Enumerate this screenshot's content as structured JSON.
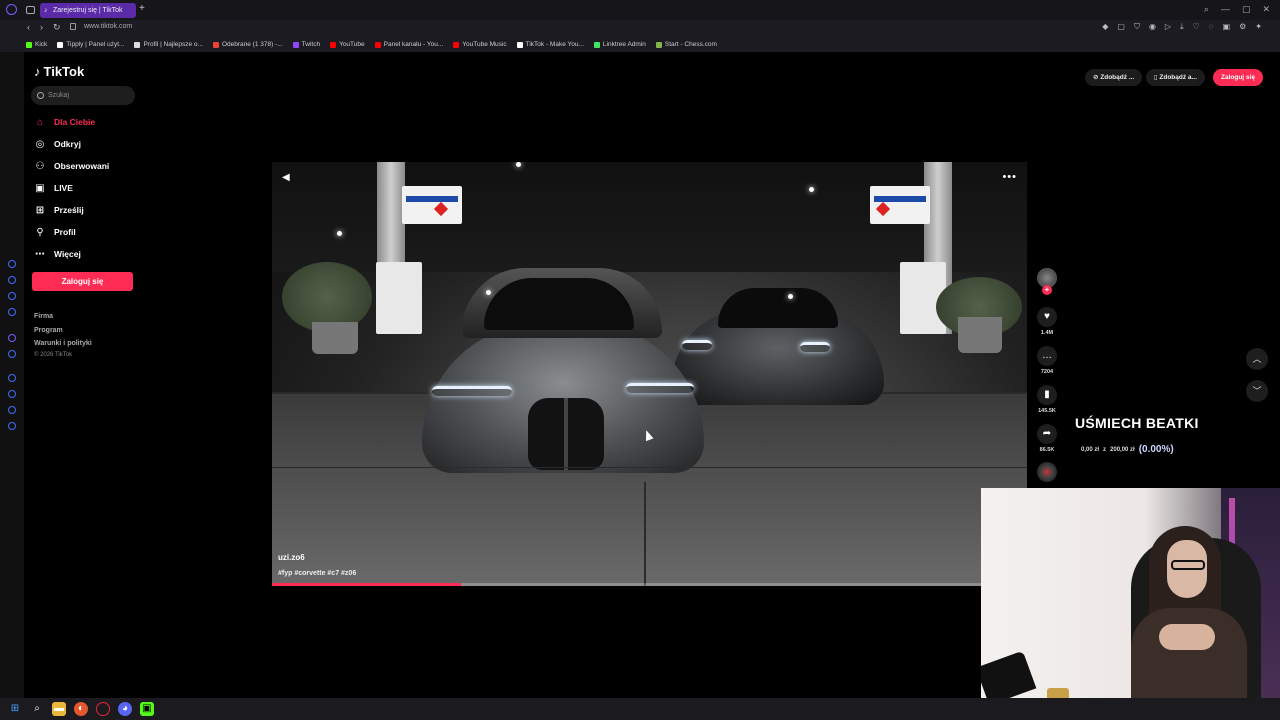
{
  "browser": {
    "tab_title": "Zarejestruj się | TikTok",
    "url": "www.tiktok.com",
    "bookmarks": [
      {
        "label": "Kick",
        "color": "#53fc18"
      },
      {
        "label": "Tipply | Panel użyt...",
        "color": "#ffffff"
      },
      {
        "label": "Profil | Najlepsze o...",
        "color": "#dddddd"
      },
      {
        "label": "Odebrane (1 378) -...",
        "color": "#ea4335"
      },
      {
        "label": "Twitch",
        "color": "#9146ff"
      },
      {
        "label": "YouTube",
        "color": "#ff0000"
      },
      {
        "label": "Panel kanału - You...",
        "color": "#ff0000"
      },
      {
        "label": "YouTube Music",
        "color": "#ff0000"
      },
      {
        "label": "TikTok - Make You...",
        "color": "#ffffff"
      },
      {
        "label": "Linktree Admin",
        "color": "#43e55e"
      },
      {
        "label": "Start - Chess.com",
        "color": "#81b64c"
      }
    ]
  },
  "sidebar": {
    "logo": "TikTok",
    "search_placeholder": "Szukaj",
    "nav": [
      {
        "label": "Dla Ciebie",
        "icon": "home-icon",
        "active": true
      },
      {
        "label": "Odkryj",
        "icon": "compass-icon"
      },
      {
        "label": "Obserwowani",
        "icon": "following-icon"
      },
      {
        "label": "LIVE",
        "icon": "live-icon"
      },
      {
        "label": "Prześlij",
        "icon": "upload-icon"
      },
      {
        "label": "Profil",
        "icon": "profile-icon"
      },
      {
        "label": "Więcej",
        "icon": "more-icon"
      }
    ],
    "login_label": "Zaloguj się",
    "footer": [
      "Firma",
      "Program",
      "Warunki i polityki"
    ],
    "copyright": "© 2026 TikTok"
  },
  "header": {
    "btn1": "Zdobądź ...",
    "btn2": "Zdobądź a...",
    "login": "Zaloguj się"
  },
  "video": {
    "author": "uzi.zo6",
    "caption": "#fyp #corvette #c7 #z06",
    "progress": 0.25,
    "stats": {
      "likes": "1.4M",
      "comments": "7204",
      "saves": "145.5K",
      "shares": "86.5K"
    }
  },
  "overlay": {
    "title": "UŚMIECH BEATKI",
    "current": "0,00 zł",
    "separator": "z",
    "goal": "200,00 zł",
    "percent": "(0.00%)"
  }
}
